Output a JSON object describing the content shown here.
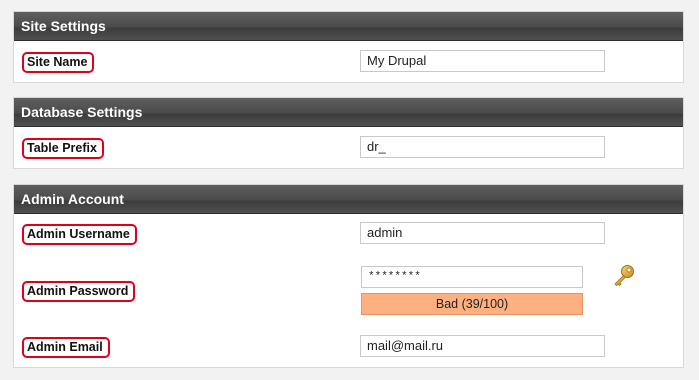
{
  "site_settings": {
    "title": "Site Settings",
    "site_name_label": "Site Name",
    "site_name_value": "My Drupal"
  },
  "database_settings": {
    "title": "Database Settings",
    "table_prefix_label": "Table Prefix",
    "table_prefix_value": "dr_"
  },
  "admin_account": {
    "title": "Admin Account",
    "username_label": "Admin Username",
    "username_value": "admin",
    "password_label": "Admin Password",
    "password_value": "********",
    "password_strength": {
      "text": "Bad (39/100)",
      "score": 39,
      "max": 100,
      "color": "#ffb080"
    },
    "password_icon": "key-icon",
    "email_label": "Admin Email",
    "email_value": "mail@mail.ru"
  },
  "colors": {
    "header_bg": "#4a4a4a",
    "label_outline": "#e0001a",
    "page_bg": "#f2f2f2"
  }
}
